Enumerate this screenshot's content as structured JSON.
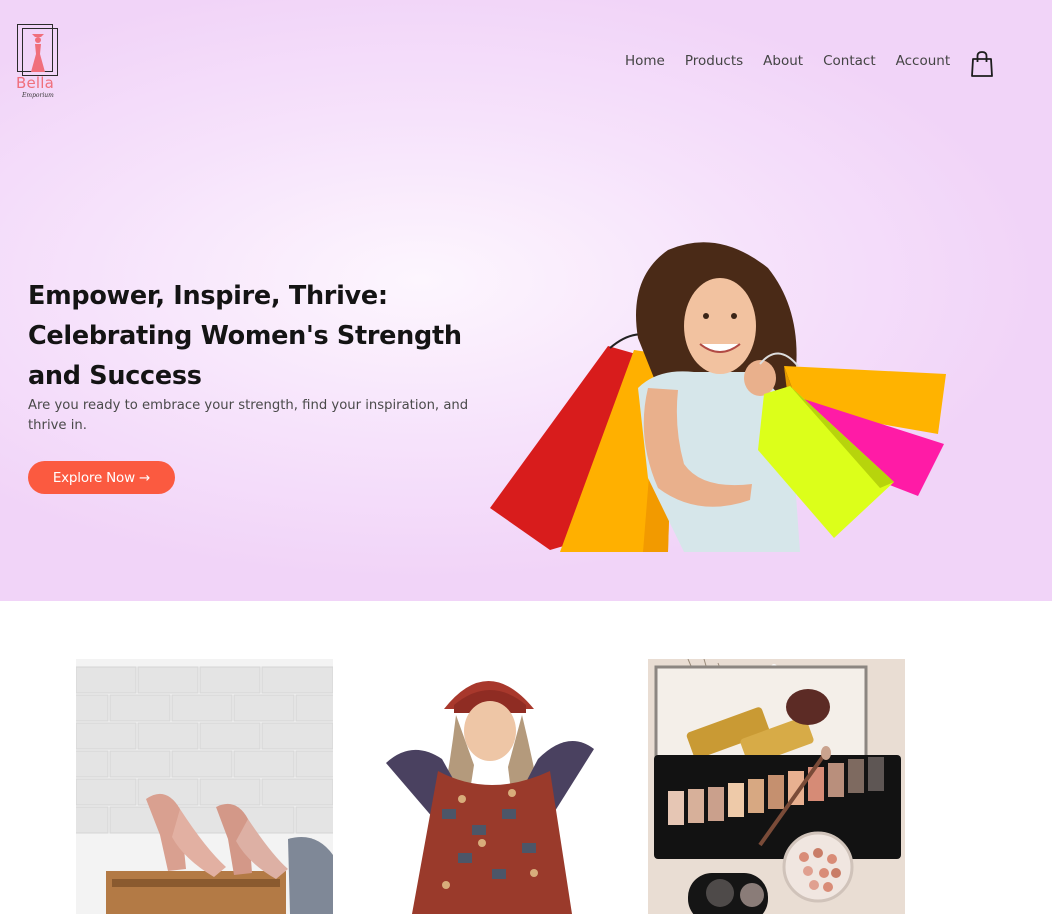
{
  "brand": {
    "name": "Bella",
    "tagline": "Emporium"
  },
  "nav": {
    "items": [
      "Home",
      "Products",
      "About",
      "Contact",
      "Account"
    ],
    "cart_icon": "shopping-bag-icon"
  },
  "hero": {
    "headline_line1": "Empower, Inspire, Thrive:",
    "headline_line2": "Celebrating Women's Strength",
    "headline_line3": "and Success",
    "subtext": "Are you ready to embrace your strength, find your inspiration, and thrive in.",
    "cta_label": "Explore Now →",
    "image": "woman-with-shopping-bags"
  },
  "colors": {
    "accent": "#fb5a40",
    "hero_bg": "#f1d4f8",
    "logo_pink": "#f06f7c"
  },
  "products": [
    {
      "image": "pink-heeled-sandals-on-shoe-rack"
    },
    {
      "image": "woman-in-red-hat-and-patterned-dress"
    },
    {
      "image": "makeup-eyeshadow-palette-and-brush"
    }
  ]
}
